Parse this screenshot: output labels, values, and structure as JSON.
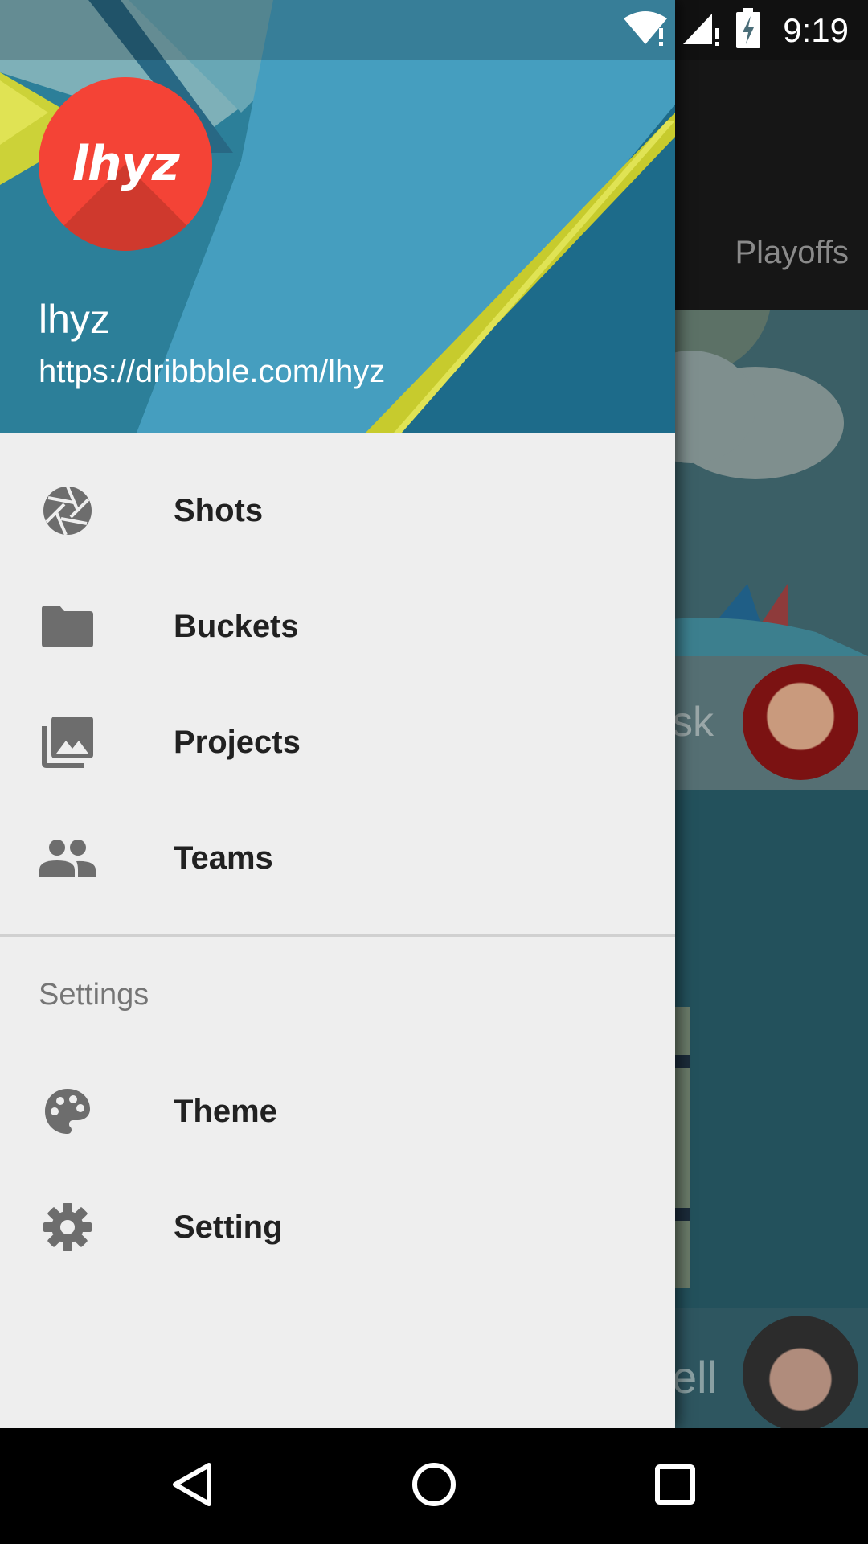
{
  "status_bar": {
    "time": "9:19"
  },
  "background": {
    "tab_label": "Playoffs",
    "card_1_text": "sk",
    "card_2_text": "ell"
  },
  "drawer": {
    "avatar_text": "lhyz",
    "user_name": "lhyz",
    "user_url": "https://dribbble.com/lhyz",
    "items": [
      {
        "label": "Shots",
        "icon": "camera-shutter-icon"
      },
      {
        "label": "Buckets",
        "icon": "folder-icon"
      },
      {
        "label": "Projects",
        "icon": "photo-library-icon"
      },
      {
        "label": "Teams",
        "icon": "people-icon"
      }
    ],
    "settings_header": "Settings",
    "settings_items": [
      {
        "label": "Theme",
        "icon": "palette-icon"
      },
      {
        "label": "Setting",
        "icon": "gear-icon"
      }
    ]
  },
  "colors": {
    "avatar": "#f44336",
    "drawer_bg": "#eeeeee",
    "icon": "#6d6d6d",
    "header_accent": "#d4d830"
  },
  "nav_bar": {
    "icons": [
      "back-icon",
      "home-icon",
      "recents-icon"
    ]
  }
}
